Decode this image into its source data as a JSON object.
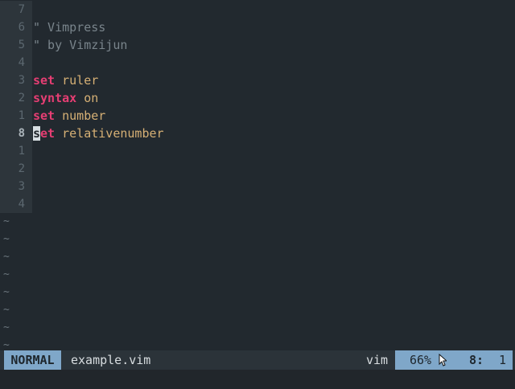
{
  "editor": {
    "lines": [
      {
        "num": "7",
        "current": false,
        "tokens": []
      },
      {
        "num": "6",
        "current": false,
        "tokens": [
          {
            "cls": "comment",
            "text": "\" Vimpress"
          }
        ]
      },
      {
        "num": "5",
        "current": false,
        "tokens": [
          {
            "cls": "comment",
            "text": "\" by Vimzijun"
          }
        ]
      },
      {
        "num": "4",
        "current": false,
        "tokens": []
      },
      {
        "num": "3",
        "current": false,
        "tokens": [
          {
            "cls": "kw",
            "text": "set"
          },
          {
            "cls": "txt",
            "text": " ruler"
          }
        ]
      },
      {
        "num": "2",
        "current": false,
        "tokens": [
          {
            "cls": "kw",
            "text": "syntax"
          },
          {
            "cls": "txt",
            "text": " on"
          }
        ]
      },
      {
        "num": "1",
        "current": false,
        "tokens": [
          {
            "cls": "kw",
            "text": "set"
          },
          {
            "cls": "txt",
            "text": " number"
          }
        ]
      },
      {
        "num": "8",
        "current": true,
        "tokens": [
          {
            "cls": "kw cursor-char",
            "text": "s"
          },
          {
            "cls": "kw",
            "text": "et"
          },
          {
            "cls": "txt",
            "text": " relativenumber"
          }
        ]
      },
      {
        "num": "1",
        "current": false,
        "tokens": []
      },
      {
        "num": "2",
        "current": false,
        "tokens": []
      },
      {
        "num": "3",
        "current": false,
        "tokens": []
      },
      {
        "num": "4",
        "current": false,
        "tokens": []
      }
    ],
    "empty_marker": "~",
    "empty_line_count": 8
  },
  "statusline": {
    "mode": "NORMAL",
    "filename": "example.vim",
    "filetype": "vim",
    "percent": "66%",
    "row": "8:",
    "col": "1"
  },
  "colors": {
    "background": "#22292f",
    "gutter": "#2d353b",
    "keyword": "#e63e73",
    "text": "#d6b075",
    "comment": "#79848b",
    "accent": "#7fa7c9"
  },
  "icons": {
    "mouse_pointer": "mouse-cursor-icon"
  }
}
